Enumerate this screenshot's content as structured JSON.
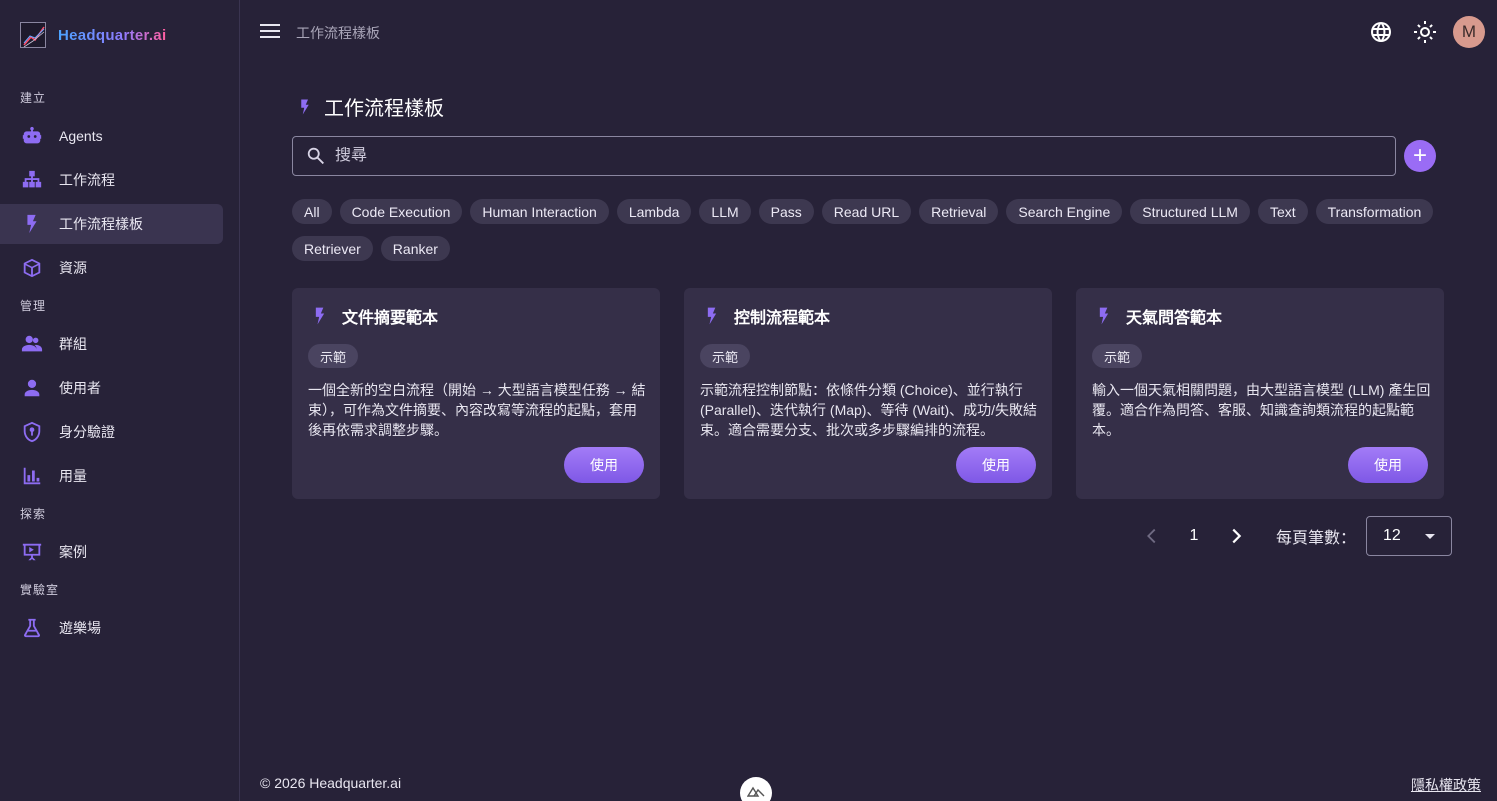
{
  "app": {
    "name": "Headquarter.ai"
  },
  "sidebar": {
    "sections": [
      {
        "title": "建立",
        "items": [
          {
            "label": "Agents",
            "icon": "robot-icon"
          },
          {
            "label": "工作流程",
            "icon": "sitemap-icon"
          },
          {
            "label": "工作流程樣板",
            "icon": "bolt-icon",
            "active": true
          },
          {
            "label": "資源",
            "icon": "cube-icon"
          }
        ]
      },
      {
        "title": "管理",
        "items": [
          {
            "label": "群組",
            "icon": "group-icon"
          },
          {
            "label": "使用者",
            "icon": "user-icon"
          },
          {
            "label": "身分驗證",
            "icon": "shield-icon"
          },
          {
            "label": "用量",
            "icon": "bar-chart-icon"
          }
        ]
      },
      {
        "title": "探索",
        "items": [
          {
            "label": "案例",
            "icon": "presentation-icon"
          }
        ]
      },
      {
        "title": "實驗室",
        "items": [
          {
            "label": "遊樂場",
            "icon": "flask-icon"
          }
        ]
      }
    ]
  },
  "header": {
    "breadcrumb": "工作流程樣板"
  },
  "main": {
    "title": "工作流程樣板",
    "search": {
      "placeholder": "搜尋",
      "value": ""
    },
    "filters": [
      "All",
      "Code Execution",
      "Human Interaction",
      "Lambda",
      "LLM",
      "Pass",
      "Read URL",
      "Retrieval",
      "Search Engine",
      "Structured LLM",
      "Text",
      "Transformation",
      "Retriever",
      "Ranker"
    ],
    "cards": [
      {
        "title": "文件摘要範本",
        "badge": "示範",
        "description": "一個全新的空白流程（開始 → 大型語言模型任務 → 結束），可作為文件摘要、內容改寫等流程的起點，套用後再依需求調整步驟。",
        "button": "使用"
      },
      {
        "title": "控制流程範本",
        "badge": "示範",
        "description": "示範流程控制節點：依條件分類 (Choice)、並行執行 (Parallel)、迭代執行 (Map)、等待 (Wait)、成功/失敗結束。適合需要分支、批次或多步驟編排的流程。",
        "button": "使用"
      },
      {
        "title": "天氣問答範本",
        "badge": "示範",
        "description": "輸入一個天氣相關問題，由大型語言模型 (LLM) 產生回覆。適合作為問答、客服、知識查詢類流程的起點範本。",
        "button": "使用"
      }
    ],
    "pagination": {
      "page": "1",
      "per_page_label": "每頁筆數：",
      "per_page": "12"
    }
  },
  "footer": {
    "copyright": "© 2026 Headquarter.ai",
    "privacy": "隱私權政策"
  },
  "colors": {
    "accent": "#8d6cf2",
    "background": "#272238",
    "card": "#352f48",
    "chip": "#3d3850"
  }
}
